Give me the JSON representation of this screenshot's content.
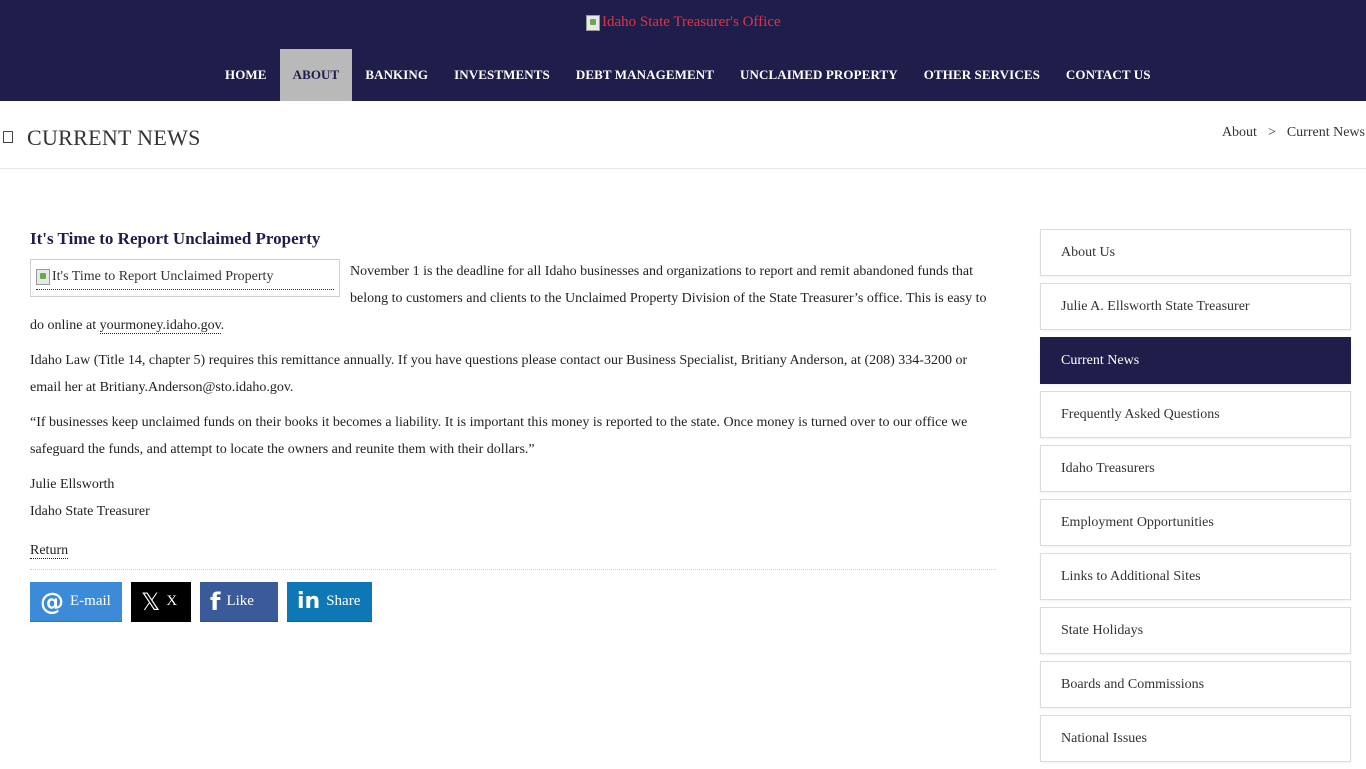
{
  "header": {
    "logo_alt": "Idaho State Treasurer's Office",
    "nav": [
      {
        "label": "HOME",
        "active": false
      },
      {
        "label": "ABOUT",
        "active": true
      },
      {
        "label": "BANKING",
        "active": false
      },
      {
        "label": "INVESTMENTS",
        "active": false
      },
      {
        "label": "DEBT MANAGEMENT",
        "active": false
      },
      {
        "label": "UNCLAIMED PROPERTY",
        "active": false
      },
      {
        "label": "OTHER SERVICES",
        "active": false
      },
      {
        "label": "CONTACT US",
        "active": false
      }
    ]
  },
  "page": {
    "title": "CURRENT NEWS",
    "breadcrumb": [
      "About",
      ">",
      "Current News"
    ]
  },
  "article": {
    "title": "It's Time to Report Unclaimed Property",
    "image_alt": "It's Time to Report Unclaimed Property",
    "p1": "November 1 is the deadline for all Idaho businesses and organizations to report and remit abandoned funds that belong to customers and clients to the Unclaimed Property Division of the State Treasurer’s office. This is easy to do online at ",
    "p1_link": "yourmoney.idaho.gov",
    "p1_end": ".",
    "p2": "Idaho Law (Title 14, chapter 5) requires this remittance annually. If you have questions please contact our Business Specialist, Britiany Anderson, at (208) 334-3200 or email her at Britiany.Anderson@sto.idaho.gov.",
    "p3": "“If businesses keep unclaimed funds on their books it becomes a liability. It is important this money is reported to the state. Once money is turned over to our office we safeguard the funds, and attempt to locate the owners and reunite them with their dollars.”",
    "sig_name": "Julie Ellsworth",
    "sig_title": "Idaho State Treasurer",
    "return_label": "Return"
  },
  "share": {
    "email": {
      "glyph": "@",
      "label": "E-mail",
      "color": "#3b8bd8"
    },
    "x": {
      "glyph": "𝕏",
      "label": "X",
      "color": "#000000"
    },
    "facebook": {
      "glyph": "f",
      "label": "Like",
      "color": "#3b5a9a"
    },
    "linkedin": {
      "glyph": "in",
      "label": "Share",
      "color": "#0e77b5"
    }
  },
  "sidebar": {
    "items": [
      {
        "label": "About Us",
        "active": false
      },
      {
        "label": "Julie A. Ellsworth State Treasurer",
        "active": false
      },
      {
        "label": "Current News",
        "active": true
      },
      {
        "label": "Frequently Asked Questions",
        "active": false
      },
      {
        "label": "Idaho Treasurers",
        "active": false
      },
      {
        "label": "Employment Opportunities",
        "active": false
      },
      {
        "label": "Links to Additional Sites",
        "active": false
      },
      {
        "label": "State Holidays",
        "active": false
      },
      {
        "label": "Boards and Commissions",
        "active": false
      },
      {
        "label": "National Issues",
        "active": false
      }
    ]
  },
  "colors": {
    "brand_navy": "#1f1d4a",
    "nav_active": "#b9b9b9",
    "logo_alt_text": "#e0334a"
  }
}
